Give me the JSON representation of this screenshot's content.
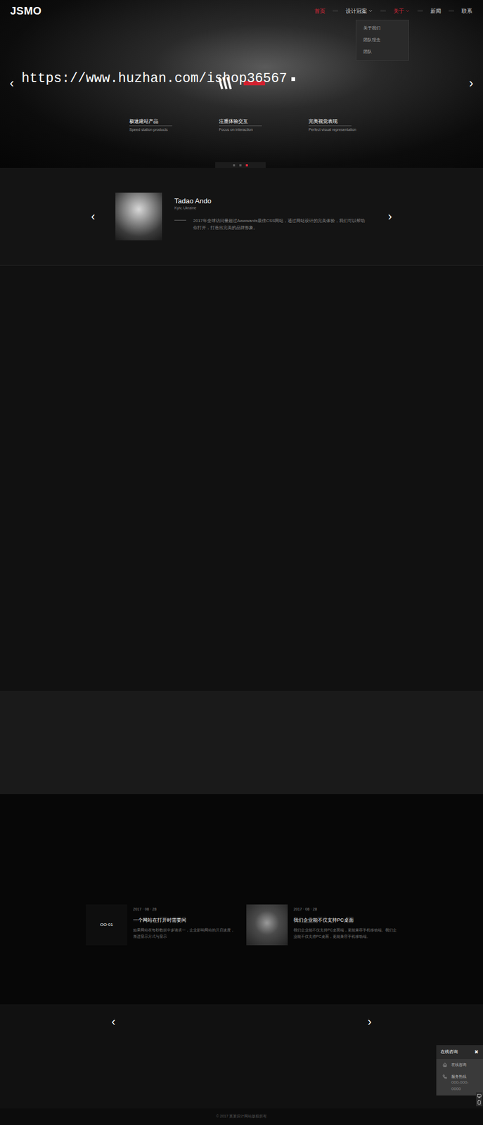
{
  "logo": "JSMO",
  "nav": [
    {
      "label": "首页",
      "selected": true,
      "hasDropdown": false,
      "expanded": false
    },
    {
      "label": "设计冠案",
      "selected": false,
      "hasDropdown": true,
      "expanded": false
    },
    {
      "label": "关于",
      "selected": false,
      "hasDropdown": true,
      "expanded": true
    },
    {
      "label": "新闻",
      "selected": false,
      "hasDropdown": false,
      "expanded": false
    },
    {
      "label": "联系",
      "selected": false,
      "hasDropdown": false,
      "expanded": false
    }
  ],
  "dropdown": [
    "关于我们",
    "团队理念",
    "团队"
  ],
  "watermark": "https://www.huzhan.com/ishop36567",
  "hero": {
    "prev": "‹",
    "next": "›",
    "features": [
      {
        "title": "极速建站产品",
        "subtitle": "Speed station products"
      },
      {
        "title": "注重体验交互",
        "subtitle": "Focus on interaction"
      },
      {
        "title": "完美视觉表现",
        "subtitle": "Perfect visual representation"
      }
    ],
    "slides": [
      {
        "selected": false
      },
      {
        "selected": false
      },
      {
        "selected": true
      }
    ]
  },
  "testimonial": {
    "name": "Tadao Ando",
    "place": "Kyiv, Ukraine",
    "text": "2017年全球访问量超过Awwwards最佳CSS网站，通过网站设计的完美体验，我们可以帮助你打开，打造出完美的品牌形象。",
    "prev": "‹",
    "next": "›"
  },
  "news": [
    {
      "date": "2017 · 08 · 28",
      "title": "一个网站在打开时需要间",
      "desc": "如果网站在每秒数据中多请求一，企业影响网站的开启速度，渐进显示方式与显示",
      "thumbText": "OO·01"
    },
    {
      "date": "2017 · 08 · 28",
      "title": "我们企业能不仅支持PC桌面",
      "desc": "我们企业能不仅支持PC桌面端，更能兼容手机移动端。我们企业能不仅支持PC桌面，更能兼容手机移动端。",
      "thumbText": ""
    }
  ],
  "newsNav": {
    "prev": "‹",
    "next": "›"
  },
  "footer": "© 2017 某某设计网站版权所有",
  "chat": {
    "title": "在线咨询",
    "close": "✖",
    "items": [
      {
        "label": "在线咨询",
        "value": ""
      },
      {
        "label": "服务热线",
        "value": "000-000-0000"
      }
    ]
  }
}
